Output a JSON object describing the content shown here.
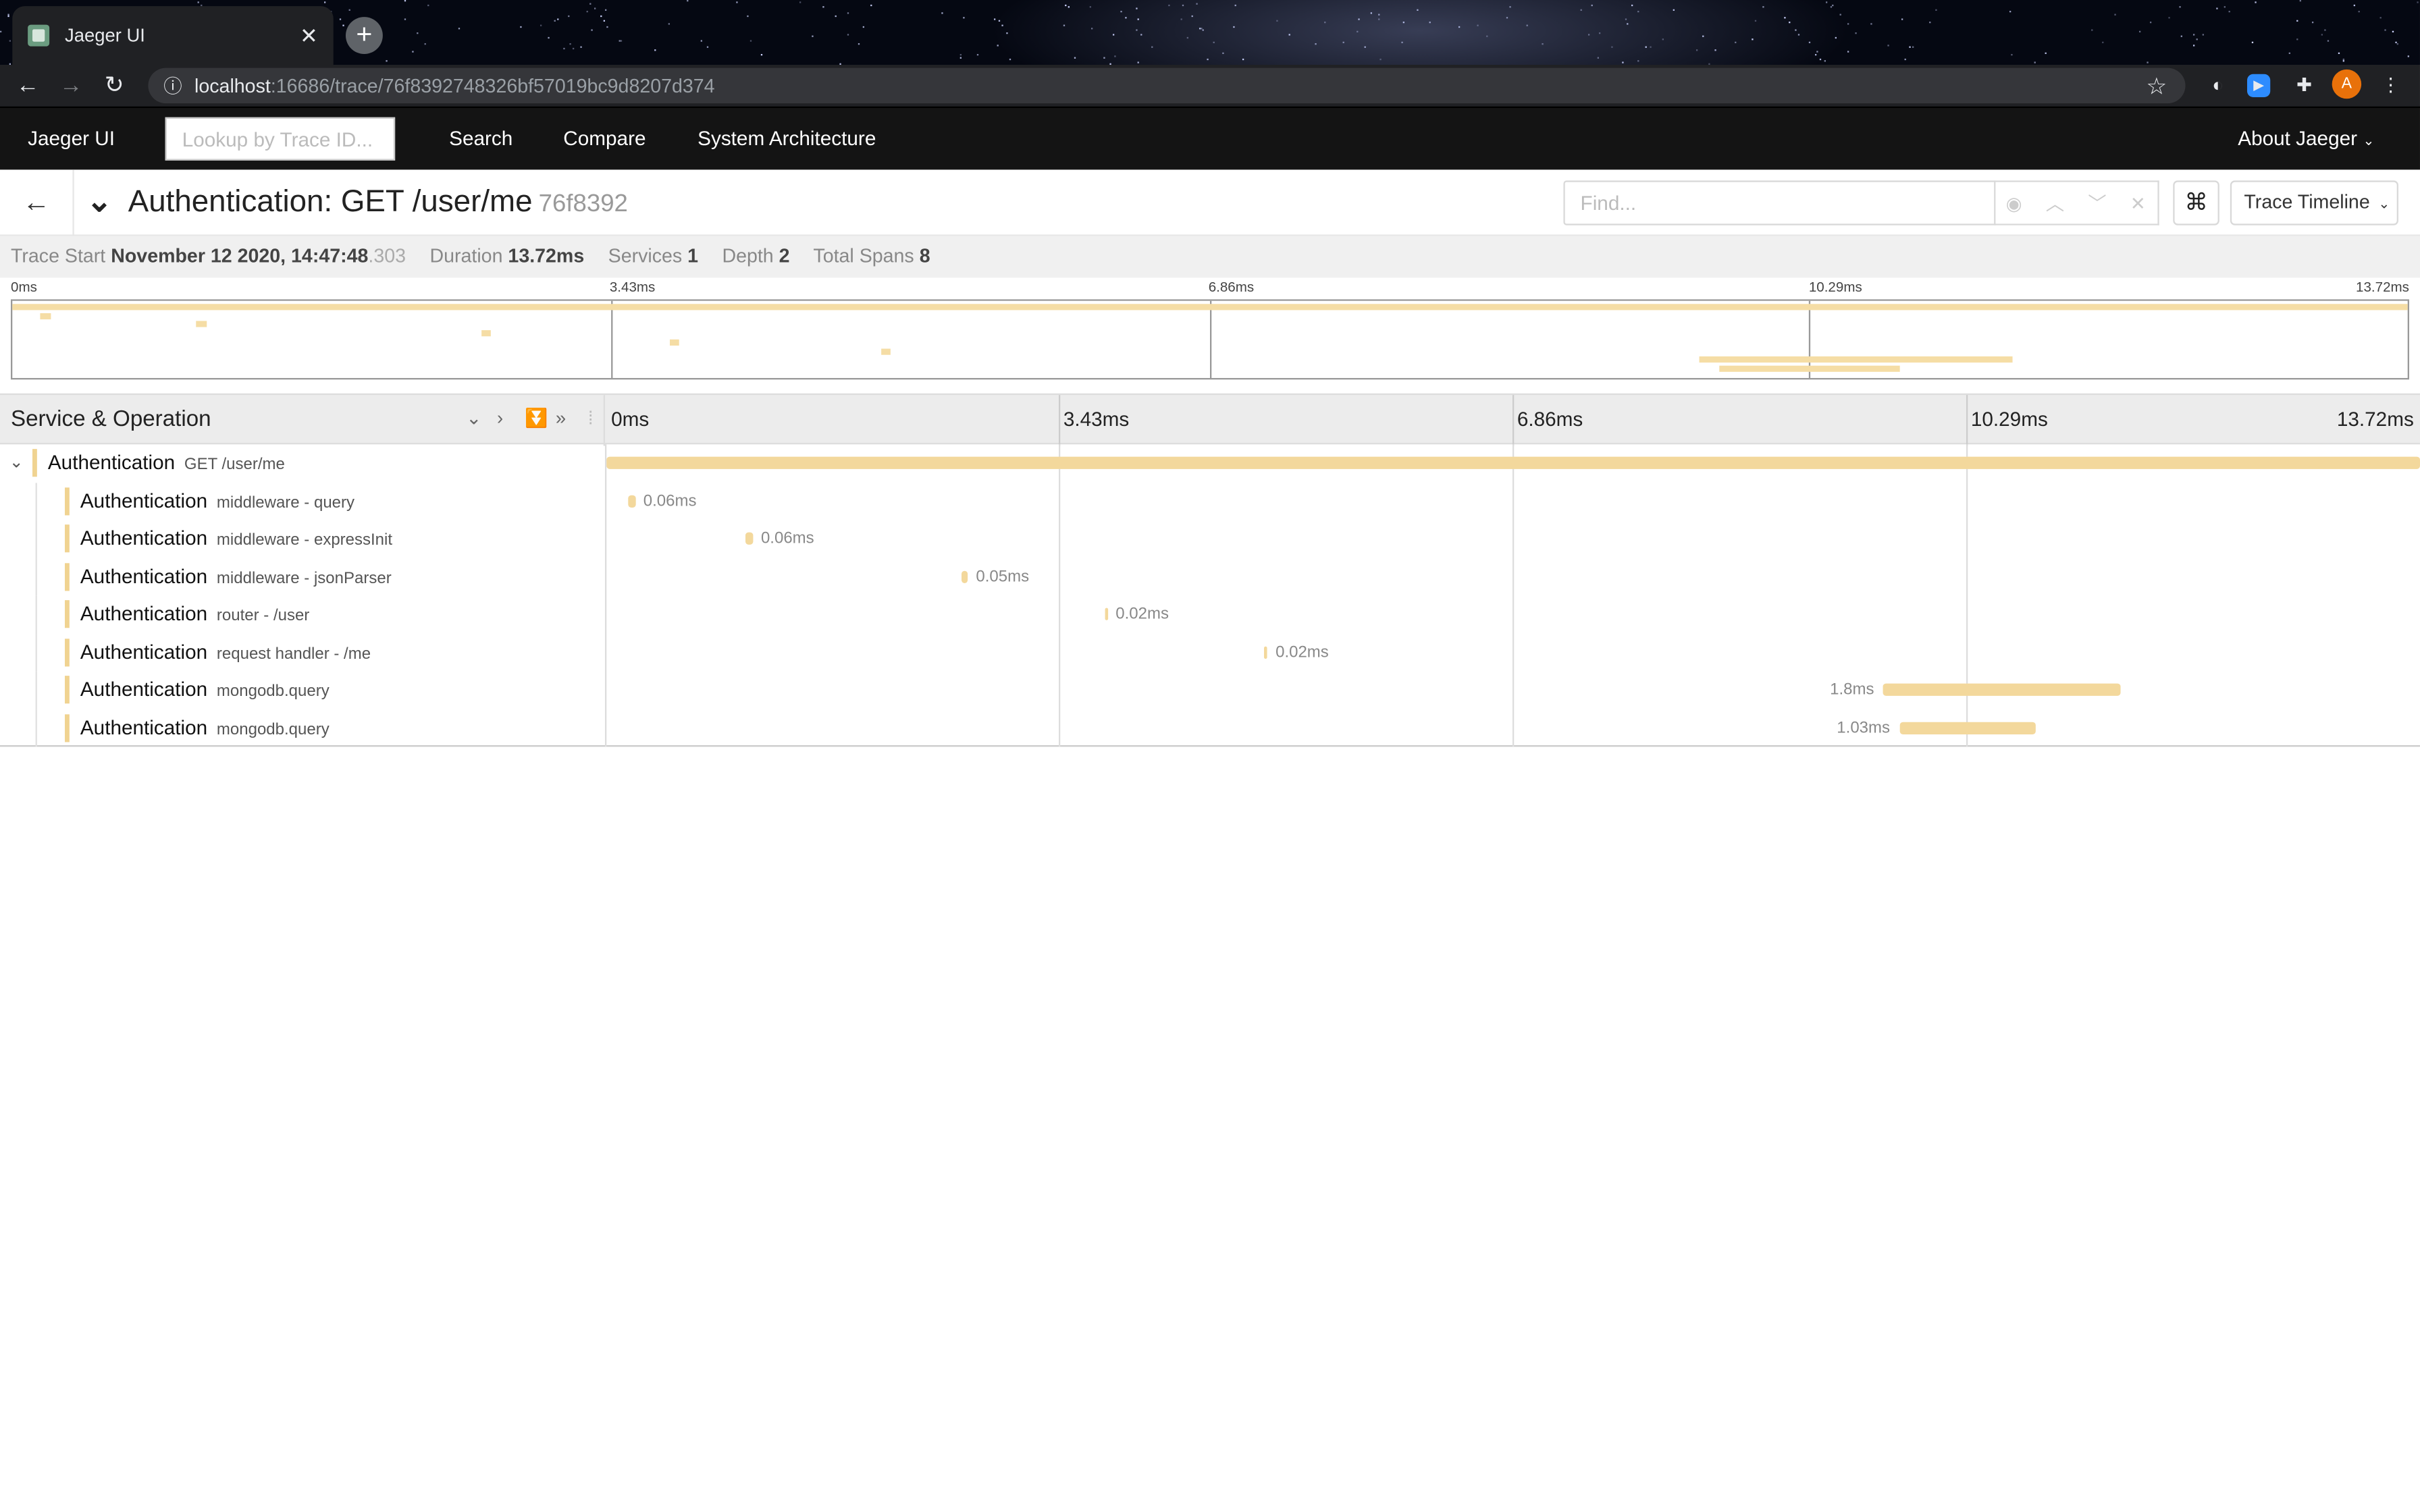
{
  "browser": {
    "tab_title": "Jaeger UI",
    "url_host": "localhost",
    "url_path": ":16686/trace/76f8392748326bf57019bc9d8207d374",
    "avatar_letter": "A"
  },
  "nav": {
    "brand": "Jaeger UI",
    "lookup_placeholder": "Lookup by Trace ID...",
    "search": "Search",
    "compare": "Compare",
    "architecture": "System Architecture",
    "about": "About Jaeger"
  },
  "trace": {
    "title": "Authentication: GET /user/me",
    "trace_id_short": "76f8392",
    "find_placeholder": "Find...",
    "view_select": "Trace Timeline"
  },
  "summary": {
    "start_label": "Trace Start",
    "start_value": "November 12 2020, 14:47:48",
    "start_ms": ".303",
    "duration_label": "Duration",
    "duration_value": "13.72ms",
    "services_label": "Services",
    "services_value": "1",
    "depth_label": "Depth",
    "depth_value": "2",
    "spans_label": "Total Spans",
    "spans_value": "8"
  },
  "timeline": {
    "ticks": [
      "0ms",
      "3.43ms",
      "6.86ms",
      "10.29ms",
      "13.72ms"
    ],
    "column_title": "Service & Operation",
    "total_ms": 13.72
  },
  "spans": [
    {
      "service": "Authentication",
      "operation": "GET /user/me",
      "start_ms": 0.0,
      "duration_ms": 13.72,
      "duration_label": "",
      "root": true
    },
    {
      "service": "Authentication",
      "operation": "middleware - query",
      "start_ms": 0.16,
      "duration_ms": 0.06,
      "duration_label": "0.06ms"
    },
    {
      "service": "Authentication",
      "operation": "middleware - expressInit",
      "start_ms": 1.05,
      "duration_ms": 0.06,
      "duration_label": "0.06ms"
    },
    {
      "service": "Authentication",
      "operation": "middleware - jsonParser",
      "start_ms": 2.69,
      "duration_ms": 0.05,
      "duration_label": "0.05ms"
    },
    {
      "service": "Authentication",
      "operation": "router - /user",
      "start_ms": 3.77,
      "duration_ms": 0.02,
      "duration_label": "0.02ms"
    },
    {
      "service": "Authentication",
      "operation": "request handler - /me",
      "start_ms": 4.98,
      "duration_ms": 0.02,
      "duration_label": "0.02ms"
    },
    {
      "service": "Authentication",
      "operation": "mongodb.query",
      "start_ms": 9.66,
      "duration_ms": 1.8,
      "duration_label": "1.8ms",
      "label_left": true
    },
    {
      "service": "Authentication",
      "operation": "mongodb.query",
      "start_ms": 9.78,
      "duration_ms": 1.03,
      "duration_label": "1.03ms",
      "label_left": true
    }
  ],
  "colors": {
    "span": "#f3d89c",
    "service_marker": "#f0d391",
    "nav_bg": "#141414"
  }
}
